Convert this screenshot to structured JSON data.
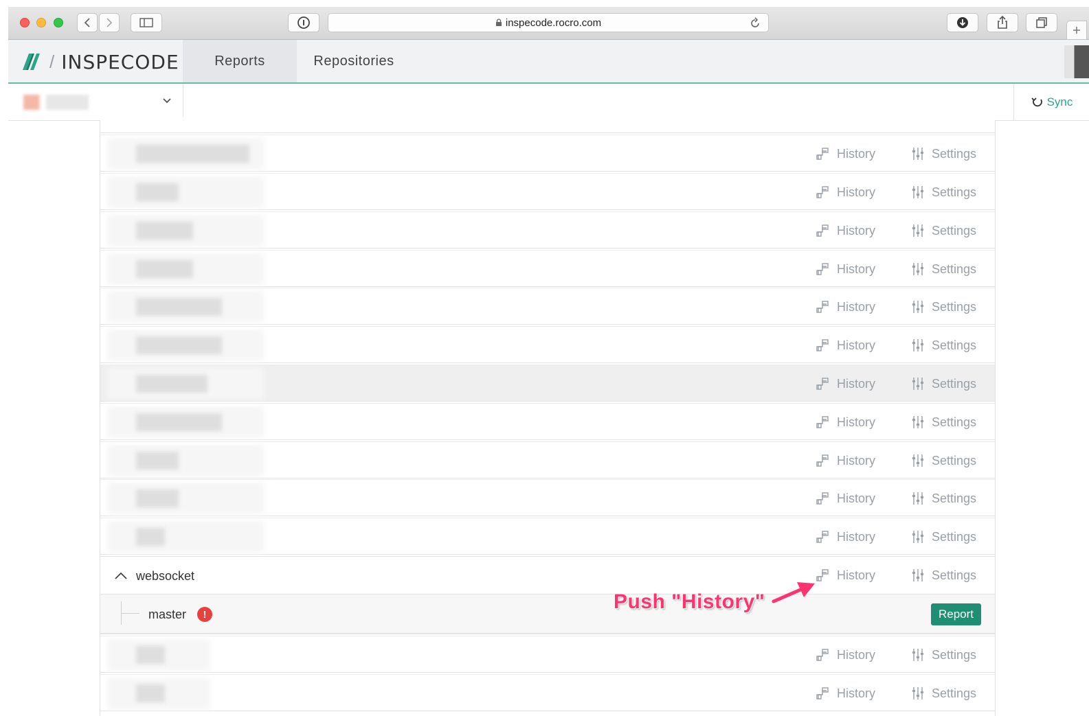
{
  "browser": {
    "url": "inspecode.rocro.com"
  },
  "header": {
    "brand": "INSPECODE",
    "separator": "/",
    "tabs": [
      {
        "label": "Reports"
      },
      {
        "label": "Repositories"
      }
    ]
  },
  "toolbar": {
    "sync_label": "Sync"
  },
  "actions": {
    "history_label": "History",
    "settings_label": "Settings"
  },
  "repo": {
    "name": "websocket",
    "branch": "master",
    "warning_glyph": "!",
    "report_label": "Report"
  },
  "annotation": {
    "text": "Push \"History\""
  },
  "colors": {
    "accent": "#1f8f74",
    "sync": "#2aa58a",
    "annotation": "#ff3370",
    "warning": "#e8403c"
  }
}
